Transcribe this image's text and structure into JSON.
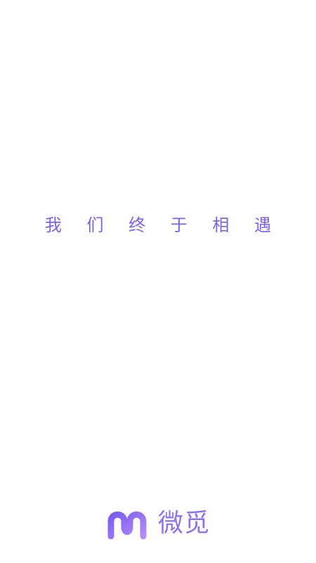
{
  "splash": {
    "slogan": "我 们 终 于 相 遇",
    "brand_name": "微觅",
    "logo_icon": "wave-m-logo-icon",
    "colors": {
      "slogan": "#7d63e6",
      "logo_gradient_start": "#7b5cf0",
      "logo_gradient_end": "#b38cf5",
      "brand_text": "#8f73ec",
      "background": "#ffffff"
    }
  }
}
